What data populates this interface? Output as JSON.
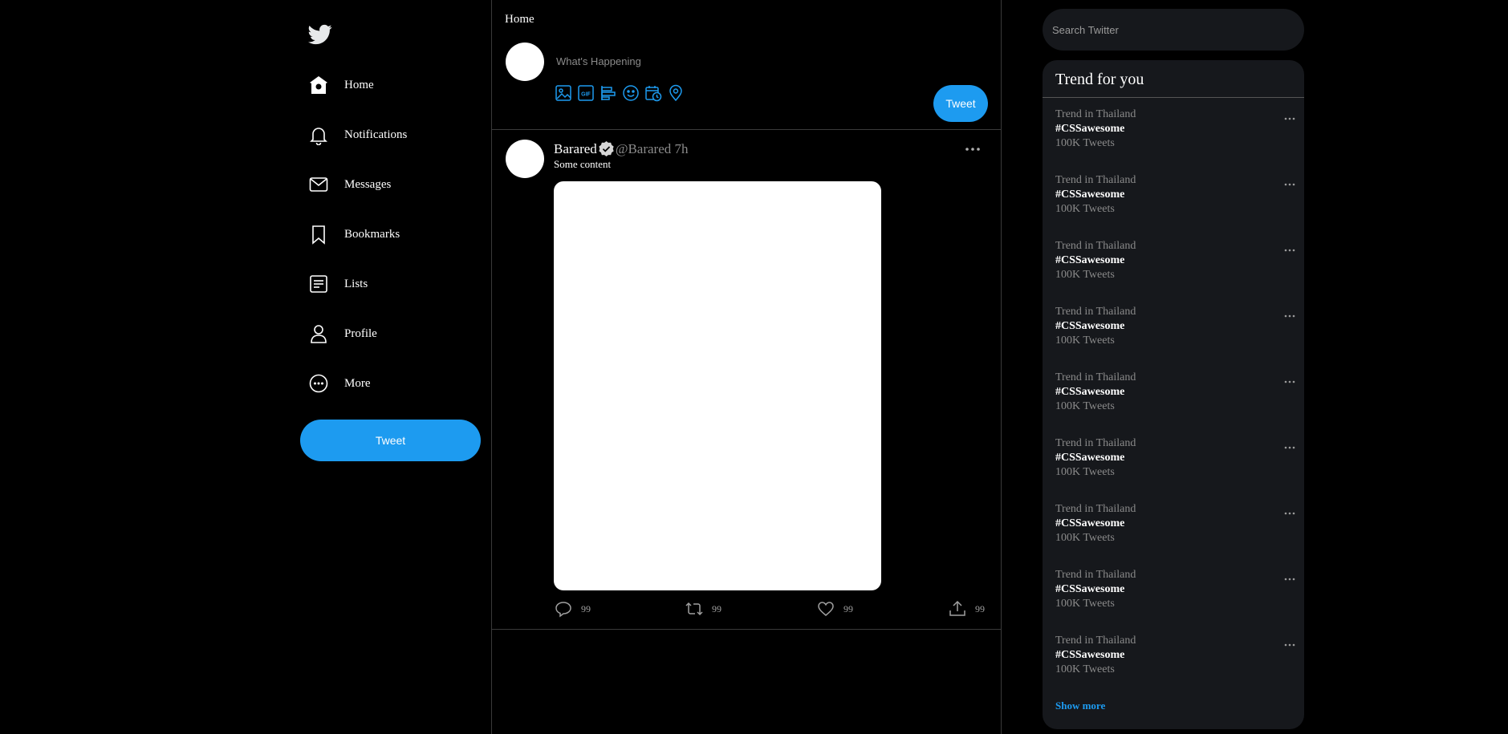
{
  "colors": {
    "accent": "#1d9bf0",
    "background": "#000000",
    "panel": "#16181c",
    "muted": "#8a8a8a"
  },
  "sidebar": {
    "logo_icon": "twitter-bird-icon",
    "items": [
      {
        "label": "Home",
        "icon": "home-icon"
      },
      {
        "label": "Notifications",
        "icon": "bell-icon"
      },
      {
        "label": "Messages",
        "icon": "envelope-icon"
      },
      {
        "label": "Bookmarks",
        "icon": "bookmark-icon"
      },
      {
        "label": "Lists",
        "icon": "list-icon"
      },
      {
        "label": "Profile",
        "icon": "person-icon"
      },
      {
        "label": "More",
        "icon": "more-circle-icon"
      }
    ],
    "tweet_label": "Tweet"
  },
  "feed": {
    "title": "Home",
    "compose": {
      "placeholder": "What's Happening",
      "tools": [
        "image-icon",
        "gif-icon",
        "poll-icon",
        "emoji-icon",
        "schedule-icon",
        "location-icon"
      ],
      "tweet_label": "Tweet"
    },
    "post": {
      "name": "Barared",
      "handle": "@Barared",
      "time": "7h",
      "text": "Some content",
      "actions": [
        {
          "icon": "reply-icon",
          "count": "99"
        },
        {
          "icon": "retweet-icon",
          "count": "99"
        },
        {
          "icon": "like-icon",
          "count": "99"
        },
        {
          "icon": "share-icon",
          "count": "99"
        }
      ]
    }
  },
  "search": {
    "placeholder": "Search Twitter"
  },
  "trends": {
    "title": "Trend for you",
    "items": [
      {
        "location": "Trend in Thailand",
        "tag": "#CSSawesome",
        "count": "100K Tweets"
      },
      {
        "location": "Trend in Thailand",
        "tag": "#CSSawesome",
        "count": "100K Tweets"
      },
      {
        "location": "Trend in Thailand",
        "tag": "#CSSawesome",
        "count": "100K Tweets"
      },
      {
        "location": "Trend in Thailand",
        "tag": "#CSSawesome",
        "count": "100K Tweets"
      },
      {
        "location": "Trend in Thailand",
        "tag": "#CSSawesome",
        "count": "100K Tweets"
      },
      {
        "location": "Trend in Thailand",
        "tag": "#CSSawesome",
        "count": "100K Tweets"
      },
      {
        "location": "Trend in Thailand",
        "tag": "#CSSawesome",
        "count": "100K Tweets"
      },
      {
        "location": "Trend in Thailand",
        "tag": "#CSSawesome",
        "count": "100K Tweets"
      },
      {
        "location": "Trend in Thailand",
        "tag": "#CSSawesome",
        "count": "100K Tweets"
      }
    ],
    "show_more": "Show more"
  }
}
